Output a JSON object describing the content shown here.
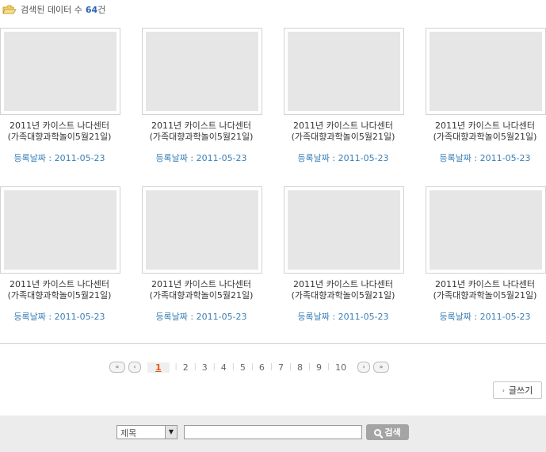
{
  "header": {
    "label": "검색된 데이터 수",
    "count": "64",
    "unit": "건",
    "icon": "folder-icon"
  },
  "items": [
    {
      "title1": "2011년 카이스트 나다센터",
      "title2": "(가족대향과학놀이5월21일)",
      "date_label": "등록날짜 : 2011-05-23"
    },
    {
      "title1": "2011년 카이스트 나다센터",
      "title2": "(가족대향과학놀이5월21일)",
      "date_label": "등록날짜 : 2011-05-23"
    },
    {
      "title1": "2011년 카이스트 나다센터",
      "title2": "(가족대향과학놀이5월21일)",
      "date_label": "등록날짜 : 2011-05-23"
    },
    {
      "title1": "2011년 카이스트 나다센터",
      "title2": "(가족대향과학놀이5월21일)",
      "date_label": "등록날짜 : 2011-05-23"
    },
    {
      "title1": "2011년 카이스트 나다센터",
      "title2": "(가족대향과학놀이5월21일)",
      "date_label": "등록날짜 : 2011-05-23"
    },
    {
      "title1": "2011년 카이스트 나다센터",
      "title2": "(가족대향과학놀이5월21일)",
      "date_label": "등록날짜 : 2011-05-23"
    },
    {
      "title1": "2011년 카이스트 나다센터",
      "title2": "(가족대향과학놀이5월21일)",
      "date_label": "등록날짜 : 2011-05-23"
    },
    {
      "title1": "2011년 카이스트 나다센터",
      "title2": "(가족대향과학놀이5월21일)",
      "date_label": "등록날짜 : 2011-05-23"
    }
  ],
  "pagination": {
    "first": "«",
    "prev": "‹",
    "next": "›",
    "last": "»",
    "pages": [
      "1",
      "2",
      "3",
      "4",
      "5",
      "6",
      "7",
      "8",
      "9",
      "10"
    ],
    "current": "1"
  },
  "write_button": {
    "label": "글쓰기"
  },
  "search": {
    "select_value": "제목",
    "input_value": "",
    "button_label": "검색"
  },
  "colors": {
    "accent": "#2c66b0",
    "date": "#3a7fb5",
    "active_page": "#e05a1a",
    "search_bg": "#ececec"
  }
}
